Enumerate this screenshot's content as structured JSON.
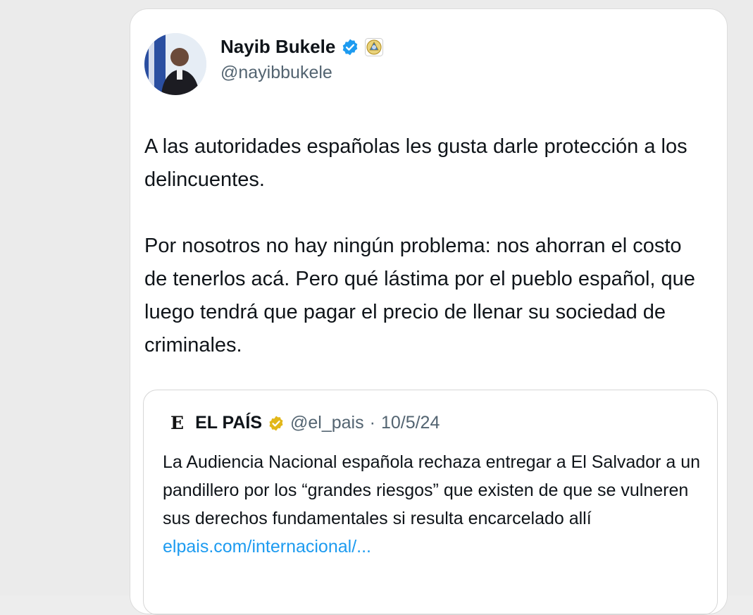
{
  "tweet": {
    "author_name": "Nayib Bukele",
    "handle": "@nayibbukele",
    "paragraphs": [
      "A las autoridades españolas les gusta darle protección a los delincuentes.",
      "Por nosotros no hay ningún problema: nos ahorran el costo de tenerlos acá. Pero qué lástima por el pueblo español, que luego tendrá que pagar el precio de llenar su sociedad de criminales."
    ]
  },
  "quote": {
    "logo_letter": "E",
    "name": "EL PAÍS",
    "handle": "@el_pais",
    "separator": "·",
    "date": "10/5/24",
    "text": "La Audiencia Nacional española rechaza entregar a El Salvador a un pandillero por los “grandes riesgos” que existen de que se vulneren sus derechos fundamentales si resulta encarcelado allí ",
    "link_text": "elpais.com/internacional/..."
  },
  "colors": {
    "verified_blue": "#1d9bf0",
    "gold_verified": "#e2b719",
    "link": "#1d9bf0",
    "secondary_text": "#536471"
  },
  "icons": {
    "verified": "verified-badge-icon",
    "org_badge": "el-salvador-seal-icon",
    "gold_verified": "gold-verified-badge-icon"
  }
}
